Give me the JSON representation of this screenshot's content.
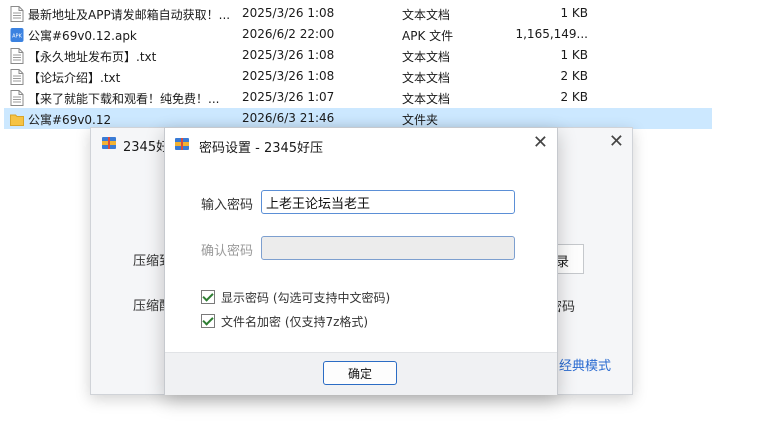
{
  "files": [
    {
      "name": "最新地址及APP请发邮箱自动获取！...",
      "date": "2025/3/26 1:08",
      "type": "文本文档",
      "size": "1 KB",
      "icon": "text-file-icon"
    },
    {
      "name": "公寓#69v0.12.apk",
      "date": "2026/6/2 22:00",
      "type": "APK 文件",
      "size": "1,165,149...",
      "icon": "apk-file-icon",
      "icon_label": "APK"
    },
    {
      "name": "【永久地址发布页】.txt",
      "date": "2025/3/26 1:08",
      "type": "文本文档",
      "size": "1 KB",
      "icon": "text-file-icon"
    },
    {
      "name": "【论坛介绍】.txt",
      "date": "2025/3/26 1:08",
      "type": "文本文档",
      "size": "2 KB",
      "icon": "text-file-icon"
    },
    {
      "name": "【来了就能下载和观看！纯免费！...",
      "date": "2025/3/26 1:07",
      "type": "文本文档",
      "size": "2 KB",
      "icon": "text-file-icon"
    },
    {
      "name": "公寓#69v0.12",
      "date": "2026/6/3 21:46",
      "type": "文件夹",
      "size": "",
      "icon": "folder-icon",
      "selected": true
    }
  ],
  "bg_window": {
    "title": "2345好",
    "label1": "压缩到",
    "label2": "压缩配",
    "button_partial": "录",
    "right_label": "密码",
    "link": "经典模式"
  },
  "dialog": {
    "title": "密码设置 - 2345好压",
    "password_label": "输入密码",
    "password_value": "上老王论坛当老王",
    "confirm_label": "确认密码",
    "show_password_label": "显示密码 (勾选可支持中文密码)",
    "encrypt_names_label": "文件名加密 (仅支持7z格式)",
    "ok_label": "确定"
  },
  "colors": {
    "selection": "#cce8ff",
    "accent": "#2b6cc4",
    "link": "#2a6bd1",
    "folder": "#f6c344"
  }
}
